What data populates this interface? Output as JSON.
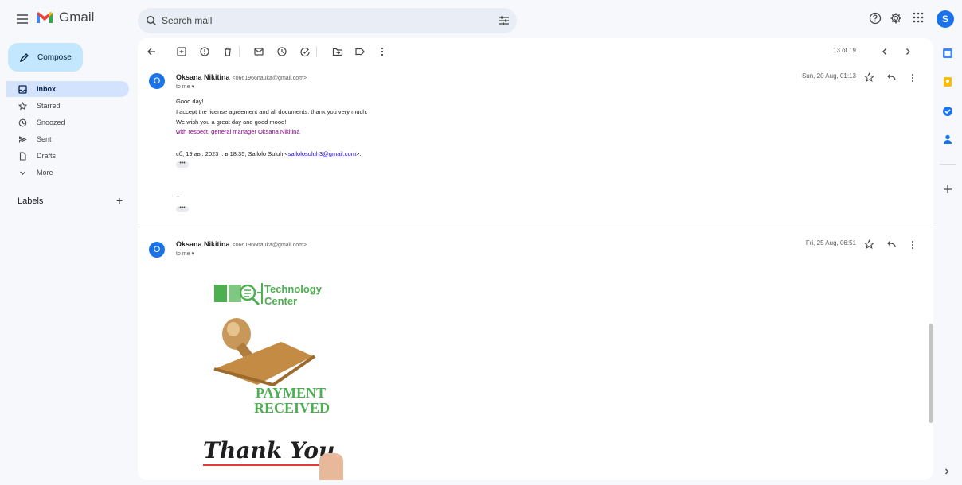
{
  "app": {
    "logo_text": "Gmail",
    "avatar_letter": "S"
  },
  "search": {
    "placeholder": "Search mail"
  },
  "compose": {
    "label": "Compose"
  },
  "nav": {
    "items": [
      {
        "label": "Inbox"
      },
      {
        "label": "Starred"
      },
      {
        "label": "Snoozed"
      },
      {
        "label": "Sent"
      },
      {
        "label": "Drafts"
      },
      {
        "label": "More"
      }
    ],
    "labels_title": "Labels",
    "labels_add": "+"
  },
  "thread": {
    "count": "13 of 19",
    "messages": [
      {
        "avatar": "O",
        "name": "Oksana Nikitina",
        "email": "<0661966nauka@gmail.com>",
        "to": "to me ▾",
        "date": "Sun, 20 Aug, 01:13",
        "body": [
          "Good day!",
          "I accept the license agreement and all documents, thank you very much.",
          "We wish you a great day and good mood!"
        ],
        "signature": "with respect, general manager Oksana Nikitina",
        "quote_prefix": "сб, 19 авг. 2023 г. в 18:35, Sallolo Suluh <",
        "quote_link": "sallolosuluh3@gmail.com",
        "quote_suffix": ">:",
        "ellipsis": "•••",
        "sig_sep": "--"
      },
      {
        "avatar": "O",
        "name": "Oksana Nikitina",
        "email": "<0661966nauka@gmail.com>",
        "to": "to me ▾",
        "date": "Fri, 25 Aug, 06:51",
        "image": {
          "logo_line1": "Technology",
          "logo_line2": "Center",
          "stamp_line1": "PAYMENT",
          "stamp_line2": "RECEIVED",
          "thanks": "Thank You"
        }
      }
    ]
  },
  "colors": {
    "accent": "#1a73e8",
    "compose_bg": "#c2e7ff",
    "active_nav": "#d3e3fd",
    "green": "#4caf50",
    "purple": "#800080"
  }
}
